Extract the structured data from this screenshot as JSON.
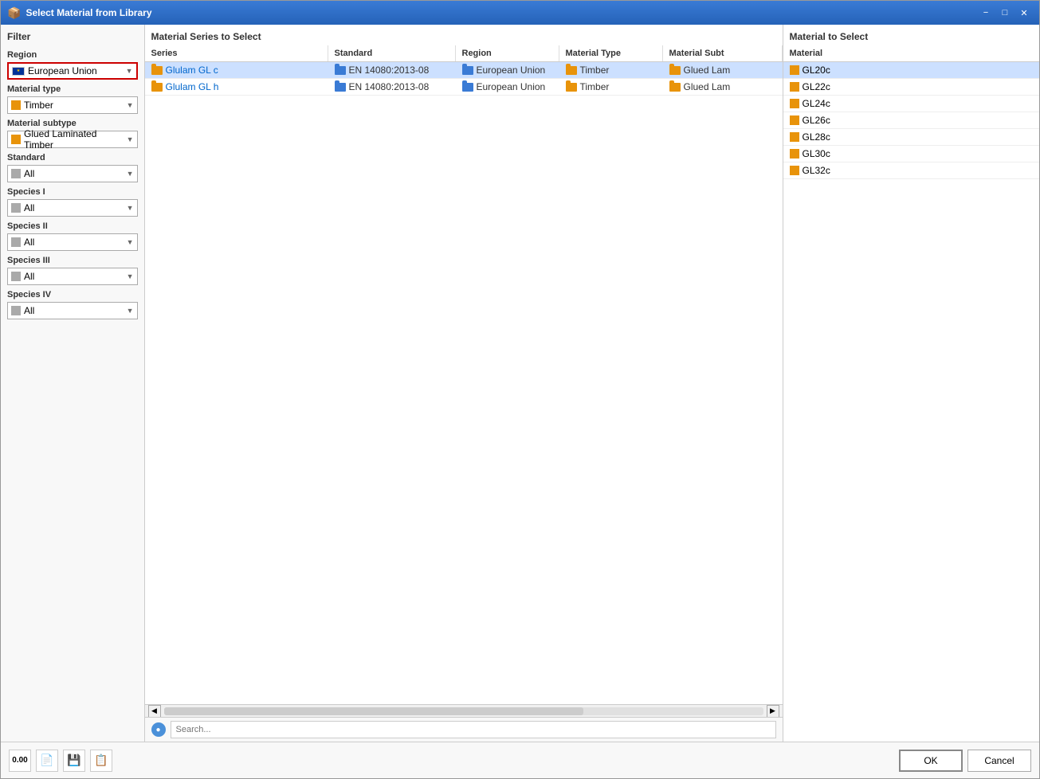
{
  "window": {
    "title": "Select Material from Library",
    "icon": "📦"
  },
  "filter": {
    "title": "Filter",
    "region_label": "Region",
    "region_value": "European Union",
    "material_type_label": "Material type",
    "material_type_value": "Timber",
    "material_subtype_label": "Material subtype",
    "material_subtype_value": "Glued Laminated Timber",
    "standard_label": "Standard",
    "standard_value": "All",
    "species1_label": "Species I",
    "species1_value": "All",
    "species2_label": "Species II",
    "species2_value": "All",
    "species3_label": "Species III",
    "species3_value": "All",
    "species4_label": "Species IV",
    "species4_value": "All"
  },
  "center": {
    "title": "Material Series to Select",
    "columns": [
      "Series",
      "Standard",
      "Region",
      "Material Type",
      "Material Subt"
    ],
    "rows": [
      {
        "series": "Glulam GL c",
        "standard": "EN 14080:2013-08",
        "region": "European Union",
        "mattype": "Timber",
        "matsub": "Glued Lam"
      },
      {
        "series": "Glulam GL h",
        "standard": "EN 14080:2013-08",
        "region": "European Union",
        "mattype": "Timber",
        "matsub": "Glued Lam"
      }
    ]
  },
  "search": {
    "placeholder": "Search..."
  },
  "right": {
    "title": "Material to Select",
    "column": "Material",
    "items": [
      "GL20c",
      "GL22c",
      "GL24c",
      "GL26c",
      "GL28c",
      "GL30c",
      "GL32c"
    ]
  },
  "bottom": {
    "ok": "OK",
    "cancel": "Cancel"
  }
}
